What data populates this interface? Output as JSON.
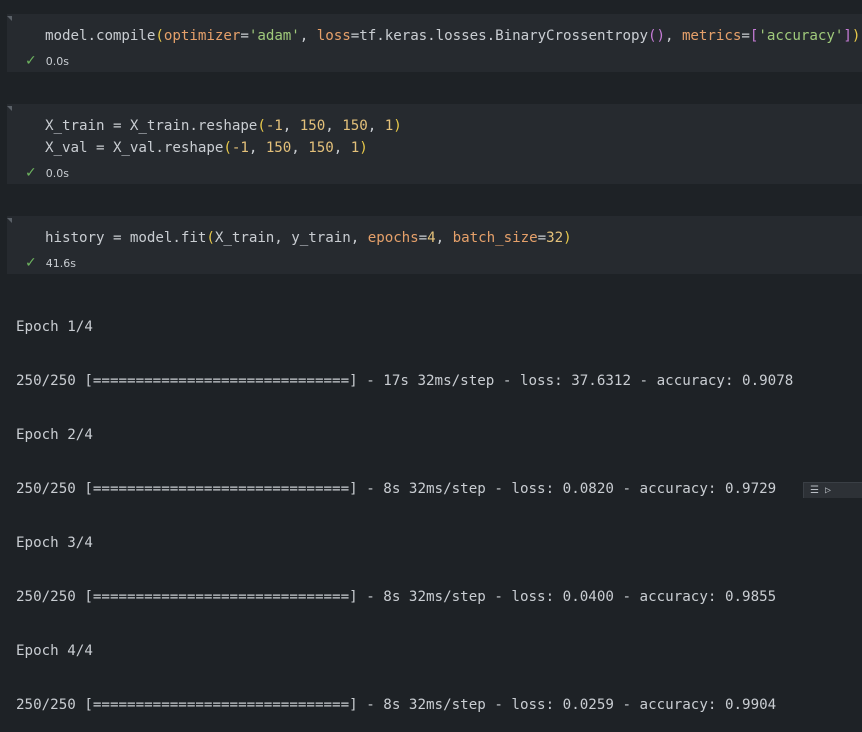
{
  "cells": [
    {
      "code_lines": [
        [
          {
            "t": "model.compile",
            "c": "fn"
          },
          {
            "t": "(",
            "c": "paren"
          },
          {
            "t": "optimizer",
            "c": "kw"
          },
          {
            "t": "=",
            "c": "op"
          },
          {
            "t": "'adam'",
            "c": "str"
          },
          {
            "t": ", ",
            "c": "op"
          },
          {
            "t": "loss",
            "c": "kw"
          },
          {
            "t": "=tf.keras.losses.BinaryCrossentropy",
            "c": "fn"
          },
          {
            "t": "()",
            "c": "br"
          },
          {
            "t": ", ",
            "c": "op"
          },
          {
            "t": "metrics",
            "c": "kw"
          },
          {
            "t": "=",
            "c": "op"
          },
          {
            "t": "[",
            "c": "br"
          },
          {
            "t": "'accuracy'",
            "c": "str"
          },
          {
            "t": "]",
            "c": "br"
          },
          {
            "t": ")",
            "c": "paren"
          }
        ]
      ],
      "status_time": "0.0s"
    },
    {
      "code_lines": [
        [
          {
            "t": "X_train ",
            "c": "fn"
          },
          {
            "t": "=",
            "c": "op"
          },
          {
            "t": " X_train.reshape",
            "c": "fn"
          },
          {
            "t": "(",
            "c": "paren"
          },
          {
            "t": "-1",
            "c": "num"
          },
          {
            "t": ", ",
            "c": "op"
          },
          {
            "t": "150",
            "c": "num"
          },
          {
            "t": ", ",
            "c": "op"
          },
          {
            "t": "150",
            "c": "num"
          },
          {
            "t": ", ",
            "c": "op"
          },
          {
            "t": "1",
            "c": "num"
          },
          {
            "t": ")",
            "c": "paren"
          }
        ],
        [
          {
            "t": "X_val ",
            "c": "fn"
          },
          {
            "t": "=",
            "c": "op"
          },
          {
            "t": " X_val.reshape",
            "c": "fn"
          },
          {
            "t": "(",
            "c": "paren"
          },
          {
            "t": "-1",
            "c": "num"
          },
          {
            "t": ", ",
            "c": "op"
          },
          {
            "t": "150",
            "c": "num"
          },
          {
            "t": ", ",
            "c": "op"
          },
          {
            "t": "150",
            "c": "num"
          },
          {
            "t": ", ",
            "c": "op"
          },
          {
            "t": "1",
            "c": "num"
          },
          {
            "t": ")",
            "c": "paren"
          }
        ]
      ],
      "status_time": "0.0s"
    },
    {
      "code_lines": [
        [
          {
            "t": "history ",
            "c": "fn"
          },
          {
            "t": "=",
            "c": "op"
          },
          {
            "t": " model.fit",
            "c": "fn"
          },
          {
            "t": "(",
            "c": "paren"
          },
          {
            "t": "X_train, y_train, ",
            "c": "fn"
          },
          {
            "t": "epochs",
            "c": "kw"
          },
          {
            "t": "=",
            "c": "op"
          },
          {
            "t": "4",
            "c": "num"
          },
          {
            "t": ", ",
            "c": "op"
          },
          {
            "t": "batch_size",
            "c": "kw"
          },
          {
            "t": "=",
            "c": "op"
          },
          {
            "t": "32",
            "c": "num"
          },
          {
            "t": ")",
            "c": "paren"
          }
        ]
      ],
      "status_time": "41.6s"
    }
  ],
  "output_lines": [
    "Epoch 1/4",
    "250/250 [==============================] - 17s 32ms/step - loss: 37.6312 - accuracy: 0.9078",
    "Epoch 2/4",
    "250/250 [==============================] - 8s 32ms/step - loss: 0.0820 - accuracy: 0.9729",
    "Epoch 3/4",
    "250/250 [==============================] - 8s 32ms/step - loss: 0.0400 - accuracy: 0.9855",
    "Epoch 4/4",
    "250/250 [==============================] - 8s 32ms/step - loss: 0.0259 - accuracy: 0.9904"
  ],
  "icons": {
    "check": "check-icon",
    "collapse": "collapse-icon",
    "output_tools": [
      "wrap-lines-icon",
      "run-icon"
    ]
  }
}
